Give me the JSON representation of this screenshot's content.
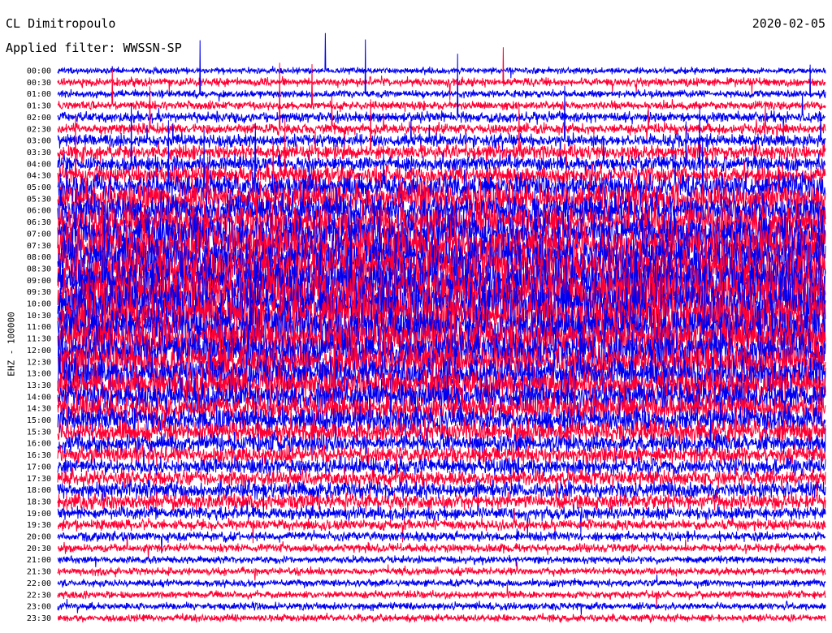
{
  "header": {
    "station": "CL Dimitropoulo",
    "filter": "Applied filter: WWSSN-SP",
    "date": "2020-02-05",
    "channel_label": "EHZ - 100000"
  },
  "colors": {
    "trace_a": "#0000f0",
    "trace_b": "#ff0033",
    "background": "#ffffff"
  },
  "chart_data": {
    "type": "line",
    "title": "CL Dimitropoulo",
    "subtitle": "Applied filter: WWSSN-SP",
    "date": "2020-02-05",
    "ylabel": "EHZ - 100000",
    "y_tick_labels": [
      "00:00",
      "00:30",
      "01:00",
      "01:30",
      "02:00",
      "02:30",
      "03:00",
      "03:30",
      "04:00",
      "04:30",
      "05:00",
      "05:30",
      "06:00",
      "06:30",
      "07:00",
      "07:30",
      "08:00",
      "08:30",
      "09:00",
      "09:30",
      "10:00",
      "10:30",
      "11:00",
      "11:30",
      "12:00",
      "12:30",
      "13:00",
      "13:30",
      "14:00",
      "14:30",
      "15:00",
      "15:30",
      "16:00",
      "16:30",
      "17:00",
      "17:30",
      "18:00",
      "18:30",
      "19:00",
      "19:30",
      "20:00",
      "20:30",
      "21:00",
      "21:30",
      "22:00",
      "22:30",
      "23:00",
      "23:30"
    ],
    "x_range_minutes": [
      0,
      30
    ],
    "alternating_colors": [
      "#0000f0",
      "#ff0033"
    ],
    "relative_noise_per_trace": [
      0.6,
      0.8,
      0.7,
      0.8,
      1.0,
      1.0,
      1.2,
      1.4,
      1.5,
      1.8,
      2.5,
      3.0,
      3.0,
      3.4,
      3.8,
      4.0,
      4.2,
      4.4,
      4.6,
      4.6,
      4.4,
      4.2,
      4.0,
      3.8,
      3.6,
      3.4,
      3.2,
      3.0,
      2.8,
      2.6,
      2.4,
      2.2,
      1.8,
      1.7,
      1.6,
      1.6,
      1.6,
      1.5,
      1.2,
      1.0,
      0.9,
      0.8,
      0.7,
      0.7,
      0.7,
      0.7,
      0.7,
      0.7
    ],
    "grid": false
  }
}
